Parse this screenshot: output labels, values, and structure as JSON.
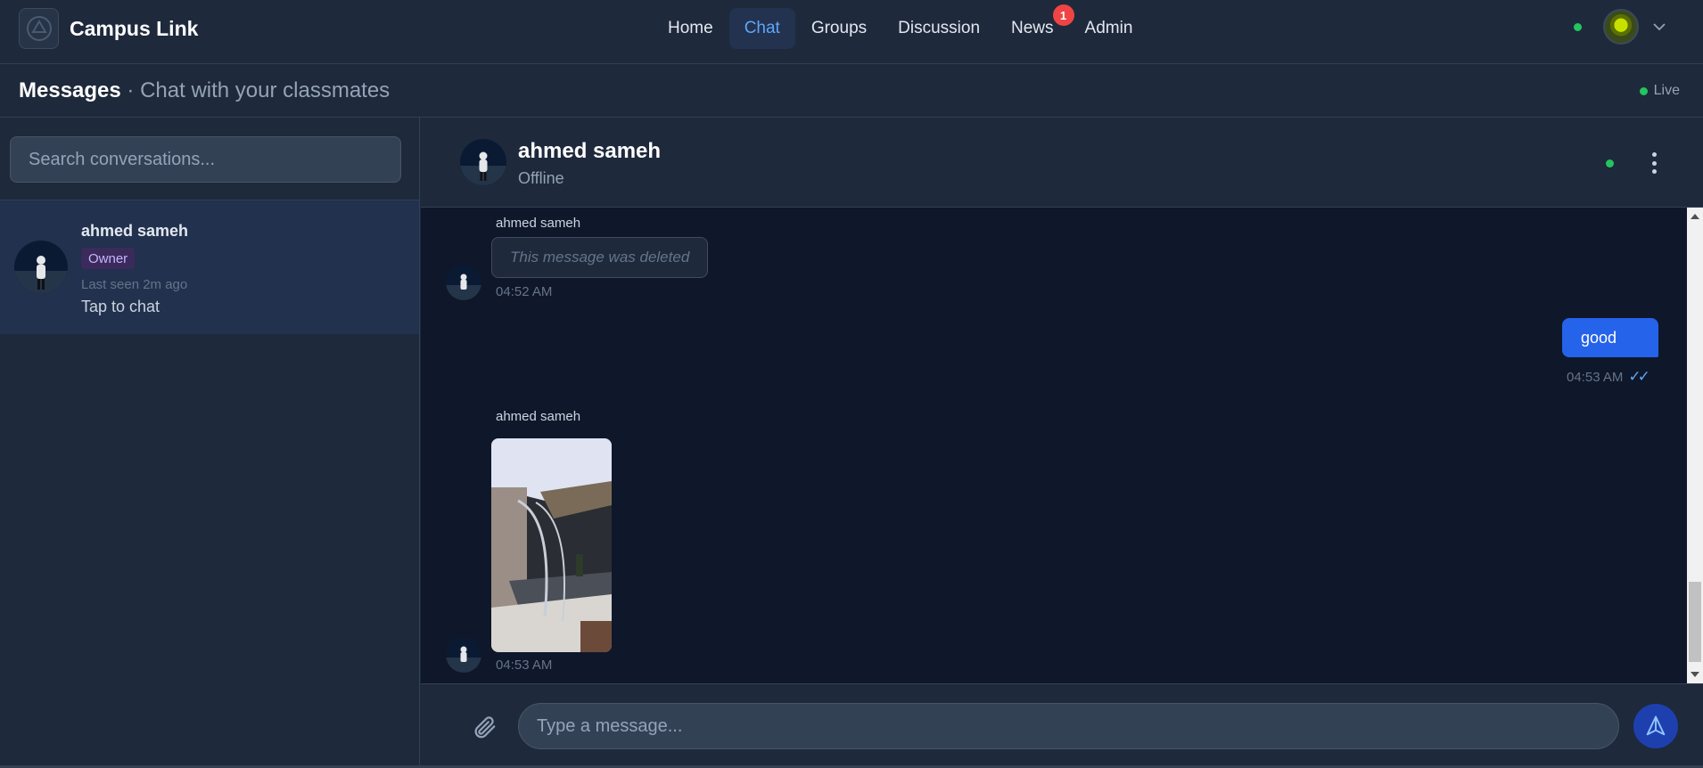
{
  "app": {
    "name": "Campus Link"
  },
  "nav": {
    "items": [
      {
        "label": "Home",
        "active": false
      },
      {
        "label": "Chat",
        "active": true
      },
      {
        "label": "Groups",
        "active": false
      },
      {
        "label": "Discussion",
        "active": false
      },
      {
        "label": "News",
        "active": false,
        "badge": "1"
      },
      {
        "label": "Admin",
        "active": false
      }
    ]
  },
  "subheader": {
    "title": "Messages",
    "subtitle": "· Chat with your classmates",
    "live_label": "Live"
  },
  "sidebar": {
    "search_placeholder": "Search conversations...",
    "conversations": [
      {
        "name": "ahmed sameh",
        "role": "Owner",
        "last_seen": "Last seen 2m ago",
        "preview": "Tap to chat"
      }
    ]
  },
  "chat": {
    "header": {
      "name": "ahmed sameh",
      "status": "Offline"
    },
    "messages": [
      {
        "sender": "ahmed sameh",
        "text": "This message was deleted",
        "time": "04:52 AM",
        "deleted": true,
        "outgoing": false
      },
      {
        "sender": "",
        "text": "good",
        "time": "04:53 AM",
        "checks": "✓✓",
        "outgoing": true
      },
      {
        "sender": "ahmed sameh",
        "type": "image",
        "time": "04:53 AM",
        "outgoing": false
      }
    ],
    "composer": {
      "placeholder": "Type a message..."
    }
  },
  "colors": {
    "background": "#1e293b",
    "chat_background": "#0f172a",
    "accent": "#2563eb",
    "active_nav": "#60a5fa",
    "online": "#22c55e",
    "badge": "#ef4444"
  },
  "icons": [
    "logo-icon",
    "chevron-down-icon",
    "more-vertical-icon",
    "paperclip-icon",
    "send-icon"
  ]
}
